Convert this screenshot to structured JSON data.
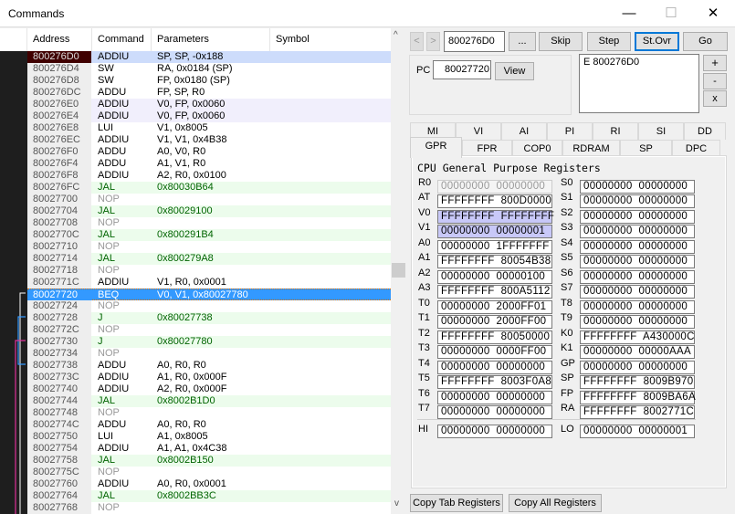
{
  "window": {
    "title": "Commands",
    "minimize": "—",
    "maximize": "☐",
    "close": "✕"
  },
  "listing": {
    "columns": [
      "Address",
      "Command",
      "Parameters",
      "Symbol"
    ],
    "rows": [
      {
        "addr": "800276D0",
        "cmd": "ADDIU",
        "params": "SP, SP, -0x188",
        "type": "sel"
      },
      {
        "addr": "800276D4",
        "cmd": "SW",
        "params": "RA, 0x0184 (SP)",
        "type": ""
      },
      {
        "addr": "800276D8",
        "cmd": "SW",
        "params": "FP, 0x0180 (SP)",
        "type": ""
      },
      {
        "addr": "800276DC",
        "cmd": "ADDU",
        "params": "FP, SP, R0",
        "type": ""
      },
      {
        "addr": "800276E0",
        "cmd": "ADDIU",
        "params": "V0, FP, 0x0060",
        "type": "hl"
      },
      {
        "addr": "800276E4",
        "cmd": "ADDIU",
        "params": "V0, FP, 0x0060",
        "type": "hl"
      },
      {
        "addr": "800276E8",
        "cmd": "LUI",
        "params": "V1, 0x8005",
        "type": ""
      },
      {
        "addr": "800276EC",
        "cmd": "ADDIU",
        "params": "V1, V1, 0x4B38",
        "type": ""
      },
      {
        "addr": "800276F0",
        "cmd": "ADDU",
        "params": "A0, V0, R0",
        "type": ""
      },
      {
        "addr": "800276F4",
        "cmd": "ADDU",
        "params": "A1, V1, R0",
        "type": ""
      },
      {
        "addr": "800276F8",
        "cmd": "ADDIU",
        "params": "A2, R0, 0x0100",
        "type": ""
      },
      {
        "addr": "800276FC",
        "cmd": "JAL",
        "params": "0x80030B64",
        "type": "jal"
      },
      {
        "addr": "80027700",
        "cmd": "NOP",
        "params": "",
        "type": "nop"
      },
      {
        "addr": "80027704",
        "cmd": "JAL",
        "params": "0x80029100",
        "type": "jal"
      },
      {
        "addr": "80027708",
        "cmd": "NOP",
        "params": "",
        "type": "nop"
      },
      {
        "addr": "8002770C",
        "cmd": "JAL",
        "params": "0x800291B4",
        "type": "jal"
      },
      {
        "addr": "80027710",
        "cmd": "NOP",
        "params": "",
        "type": "nop"
      },
      {
        "addr": "80027714",
        "cmd": "JAL",
        "params": "0x800279A8",
        "type": "jal"
      },
      {
        "addr": "80027718",
        "cmd": "NOP",
        "params": "",
        "type": "nop"
      },
      {
        "addr": "8002771C",
        "cmd": "ADDIU",
        "params": "V1, R0, 0x0001",
        "type": ""
      },
      {
        "addr": "80027720",
        "cmd": "BEQ",
        "params": "V0, V1, 0x80027780",
        "type": "pc"
      },
      {
        "addr": "80027724",
        "cmd": "NOP",
        "params": "",
        "type": "nop"
      },
      {
        "addr": "80027728",
        "cmd": "J",
        "params": "0x80027738",
        "type": "jal"
      },
      {
        "addr": "8002772C",
        "cmd": "NOP",
        "params": "",
        "type": "nop"
      },
      {
        "addr": "80027730",
        "cmd": "J",
        "params": "0x80027780",
        "type": "jal"
      },
      {
        "addr": "80027734",
        "cmd": "NOP",
        "params": "",
        "type": "nop"
      },
      {
        "addr": "80027738",
        "cmd": "ADDU",
        "params": "A0, R0, R0",
        "type": ""
      },
      {
        "addr": "8002773C",
        "cmd": "ADDIU",
        "params": "A1, R0, 0x000F",
        "type": ""
      },
      {
        "addr": "80027740",
        "cmd": "ADDIU",
        "params": "A2, R0, 0x000F",
        "type": ""
      },
      {
        "addr": "80027744",
        "cmd": "JAL",
        "params": "0x8002B1D0",
        "type": "jal"
      },
      {
        "addr": "80027748",
        "cmd": "NOP",
        "params": "",
        "type": "nop"
      },
      {
        "addr": "8002774C",
        "cmd": "ADDU",
        "params": "A0, R0, R0",
        "type": ""
      },
      {
        "addr": "80027750",
        "cmd": "LUI",
        "params": "A1, 0x8005",
        "type": ""
      },
      {
        "addr": "80027754",
        "cmd": "ADDIU",
        "params": "A1, A1, 0x4C38",
        "type": ""
      },
      {
        "addr": "80027758",
        "cmd": "JAL",
        "params": "0x8002B150",
        "type": "jal"
      },
      {
        "addr": "8002775C",
        "cmd": "NOP",
        "params": "",
        "type": "nop"
      },
      {
        "addr": "80027760",
        "cmd": "ADDIU",
        "params": "A0, R0, 0x0001",
        "type": ""
      },
      {
        "addr": "80027764",
        "cmd": "JAL",
        "params": "0x8002BB3C",
        "type": "jal"
      },
      {
        "addr": "80027768",
        "cmd": "NOP",
        "params": "",
        "type": "nop"
      }
    ]
  },
  "toolbar": {
    "back": "<",
    "forward": ">",
    "address": "800276D0",
    "browse": "...",
    "skip": "Skip",
    "step": "Step",
    "step_over": "St.Ovr",
    "go": "Go",
    "collapse": "^"
  },
  "pc": {
    "label": "PC",
    "value": "80027720",
    "view": "View"
  },
  "breakpoints": {
    "items": [
      "E 800276D0"
    ],
    "add": "+",
    "remove": "-",
    "clear": "x"
  },
  "tabs": {
    "row1": [
      "MI",
      "VI",
      "AI",
      "PI",
      "RI",
      "SI",
      "DD"
    ],
    "row2": [
      "GPR",
      "FPR",
      "COP0",
      "RDRAM",
      "SP",
      "DPC"
    ],
    "active": "GPR"
  },
  "gpr": {
    "title": "CPU General Purpose Registers",
    "left": [
      {
        "name": "R0",
        "value": "00000000  00000000",
        "state": "ro"
      },
      {
        "name": "AT",
        "value": "FFFFFFFF  800D0000",
        "state": ""
      },
      {
        "name": "V0",
        "value": "FFFFFFFF  FFFFFFFF",
        "state": "chg"
      },
      {
        "name": "V1",
        "value": "00000000  00000001",
        "state": "chg"
      },
      {
        "name": "A0",
        "value": "00000000  1FFFFFFF",
        "state": ""
      },
      {
        "name": "A1",
        "value": "FFFFFFFF  80054B38",
        "state": ""
      },
      {
        "name": "A2",
        "value": "00000000  00000100",
        "state": ""
      },
      {
        "name": "A3",
        "value": "FFFFFFFF  800A5112",
        "state": ""
      },
      {
        "name": "T0",
        "value": "00000000  2000FF01",
        "state": ""
      },
      {
        "name": "T1",
        "value": "00000000  2000FF00",
        "state": ""
      },
      {
        "name": "T2",
        "value": "FFFFFFFF  80050000",
        "state": ""
      },
      {
        "name": "T3",
        "value": "00000000  0000FF00",
        "state": ""
      },
      {
        "name": "T4",
        "value": "00000000  00000000",
        "state": ""
      },
      {
        "name": "T5",
        "value": "FFFFFFFF  8003F0A8",
        "state": ""
      },
      {
        "name": "T6",
        "value": "00000000  00000000",
        "state": ""
      },
      {
        "name": "T7",
        "value": "00000000  00000000",
        "state": ""
      }
    ],
    "right": [
      {
        "name": "S0",
        "value": "00000000  00000000"
      },
      {
        "name": "S1",
        "value": "00000000  00000000"
      },
      {
        "name": "S2",
        "value": "00000000  00000000"
      },
      {
        "name": "S3",
        "value": "00000000  00000000"
      },
      {
        "name": "S4",
        "value": "00000000  00000000"
      },
      {
        "name": "S5",
        "value": "00000000  00000000"
      },
      {
        "name": "S6",
        "value": "00000000  00000000"
      },
      {
        "name": "S7",
        "value": "00000000  00000000"
      },
      {
        "name": "T8",
        "value": "00000000  00000000"
      },
      {
        "name": "T9",
        "value": "00000000  00000000"
      },
      {
        "name": "K0",
        "value": "FFFFFFFF  A430000C"
      },
      {
        "name": "K1",
        "value": "00000000  00000AAA"
      },
      {
        "name": "GP",
        "value": "00000000  00000000"
      },
      {
        "name": "SP",
        "value": "FFFFFFFF  8009B970"
      },
      {
        "name": "FP",
        "value": "FFFFFFFF  8009BA6A"
      },
      {
        "name": "RA",
        "value": "FFFFFFFF  8002771C"
      }
    ],
    "hi": {
      "name": "HI",
      "value": "00000000  00000000"
    },
    "lo": {
      "name": "LO",
      "value": "00000000  00000001"
    }
  },
  "bottom": {
    "copy_tab": "Copy Tab Registers",
    "copy_all": "Copy All Registers"
  },
  "colors": {
    "jump_row": "#ecfcec",
    "jump_text": "#006400",
    "pc_row": "#3399ff",
    "selected_row": "#cddcfb",
    "branch_white": "#ffffff",
    "branch_blue": "#3399ff",
    "branch_magenta": "#e0309a"
  }
}
